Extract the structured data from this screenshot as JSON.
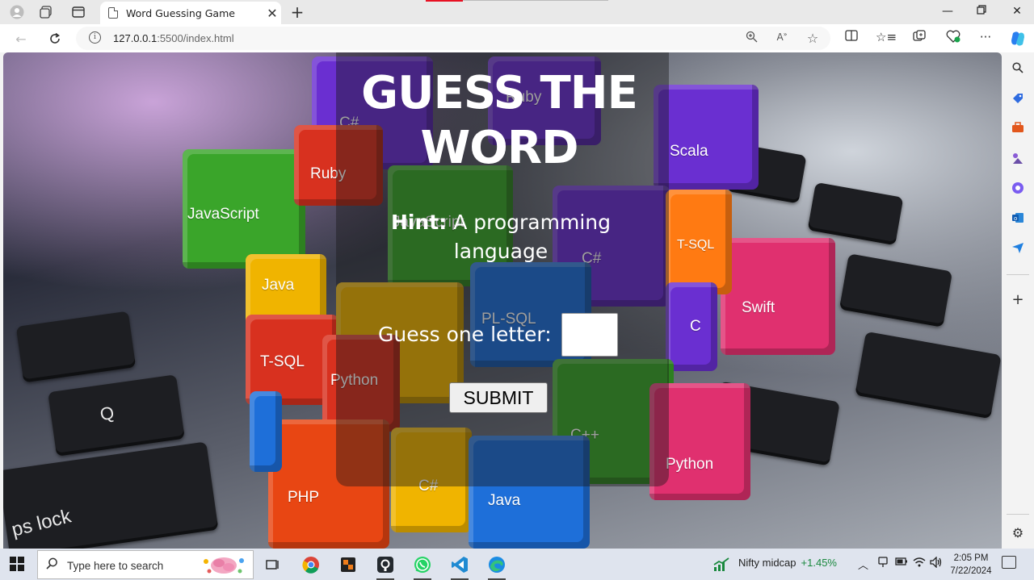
{
  "browser": {
    "tab_title": "Word Guessing Game",
    "url_host": "127.0.0.1",
    "url_rest": ":5500/index.html"
  },
  "game": {
    "title_line1": "GUESS THE",
    "title_line2": "WORD",
    "hint_label": "Hint:",
    "hint_text": "A programming language",
    "guess_label": "Guess one letter:",
    "guess_value": "",
    "submit_label": "SUBMIT"
  },
  "background_cubes": [
    "JavaScript",
    "Ruby",
    "C#",
    "Scala",
    "Swift",
    "Java",
    "T-SQL",
    "PL-SQL",
    "Python",
    "PHP",
    "C++",
    "C"
  ],
  "taskbar": {
    "search_placeholder": "Type here to search",
    "widget_name": "Nifty midcap",
    "widget_change": "+1.45%",
    "time": "2:05 PM",
    "date": "7/22/2024"
  },
  "colors": {
    "accent_edge": "#0078d4",
    "cube_green": "#3aa52a",
    "cube_purple": "#6a2fd1",
    "cube_red": "#d8311f",
    "cube_yellow": "#f0b400",
    "cube_pink": "#e0306f",
    "cube_blue": "#1e6fd9",
    "cube_orange": "#ff7a12"
  }
}
